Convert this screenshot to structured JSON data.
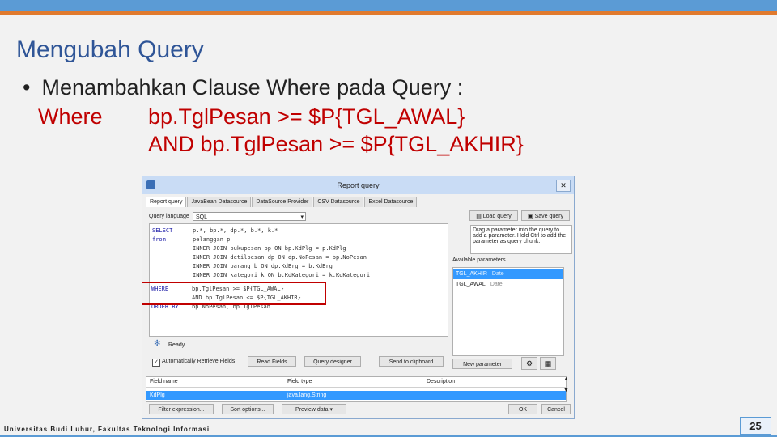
{
  "slide": {
    "title": "Mengubah Query",
    "bullet_marker": "•",
    "bullet_text": "Menambahkan Clause Where pada Query :",
    "code_keyword": "Where",
    "code_line1": "bp.TglPesan >= $P{TGL_AWAL}",
    "code_line2": "AND bp.TglPesan >= $P{TGL_AKHIR}",
    "footer": "Universitas Budi Luhur, Fakultas Teknologi Informasi",
    "page_number": "25",
    "colors": {
      "title": "#2f5597",
      "code": "#c00000",
      "topbar": "#5b9bd5",
      "accent_line": "#e07a2e"
    }
  },
  "dialog": {
    "title": "Report query",
    "close_glyph": "✕",
    "tabs": [
      "Report query",
      "JavaBean Datasource",
      "DataSource Provider",
      "CSV Datasource",
      "Excel Datasource"
    ],
    "query_language_label": "Query language",
    "query_language_value": "SQL",
    "load_query_label": "Load query",
    "save_query_label": "Save query",
    "sql_lines": [
      {
        "kw": "SELECT",
        "text": "p.*, bp.*, dp.*, b.*, k.*"
      },
      {
        "kw": "from",
        "text": "pelanggan p"
      },
      {
        "kw": "",
        "text": "INNER JOIN bukupesan bp ON bp.KdPlg = p.KdPlg"
      },
      {
        "kw": "",
        "text": "INNER JOIN detilpesan dp ON dp.NoPesan = bp.NoPesan"
      },
      {
        "kw": "",
        "text": "INNER JOIN barang b ON dp.KdBrg = b.KdBrg"
      },
      {
        "kw": "",
        "text": "INNER JOIN kategori k ON b.KdKategori = k.KdKategori"
      },
      {
        "kw": "WHERE",
        "text": "bp.TglPesan >= $P{TGL_AWAL}"
      },
      {
        "kw": "",
        "text": "AND bp.TglPesan <= $P{TGL_AKHIR}"
      },
      {
        "kw": "ORDER BY",
        "text": "bp.NoPesan, bp.TglPesan"
      }
    ],
    "status_text": "Ready",
    "auto_retrieve_label": "Automatically Retrieve Fields",
    "read_fields_label": "Read Fields",
    "query_designer_label": "Query designer",
    "send_clipboard_label": "Send to clipboard",
    "hint_text": "Drag a parameter into the query to add a parameter. Hold Ctrl to add the parameter as query chunk.",
    "available_params_label": "Available parameters",
    "parameters": [
      {
        "name": "TGL_AKHIR",
        "type": "Date",
        "selected": true
      },
      {
        "name": "TGL_AWAL",
        "type": "Date",
        "selected": false
      }
    ],
    "new_parameter_label": "New parameter",
    "field_headers": [
      "Field name",
      "Field type",
      "Description"
    ],
    "field_row": {
      "name": "KdPlg",
      "type": "java.lang.String",
      "description": ""
    },
    "filter_expression_label": "Filter expression...",
    "sort_options_label": "Sort options...",
    "preview_data_label": "Preview data",
    "ok_label": "OK",
    "cancel_label": "Cancel"
  }
}
